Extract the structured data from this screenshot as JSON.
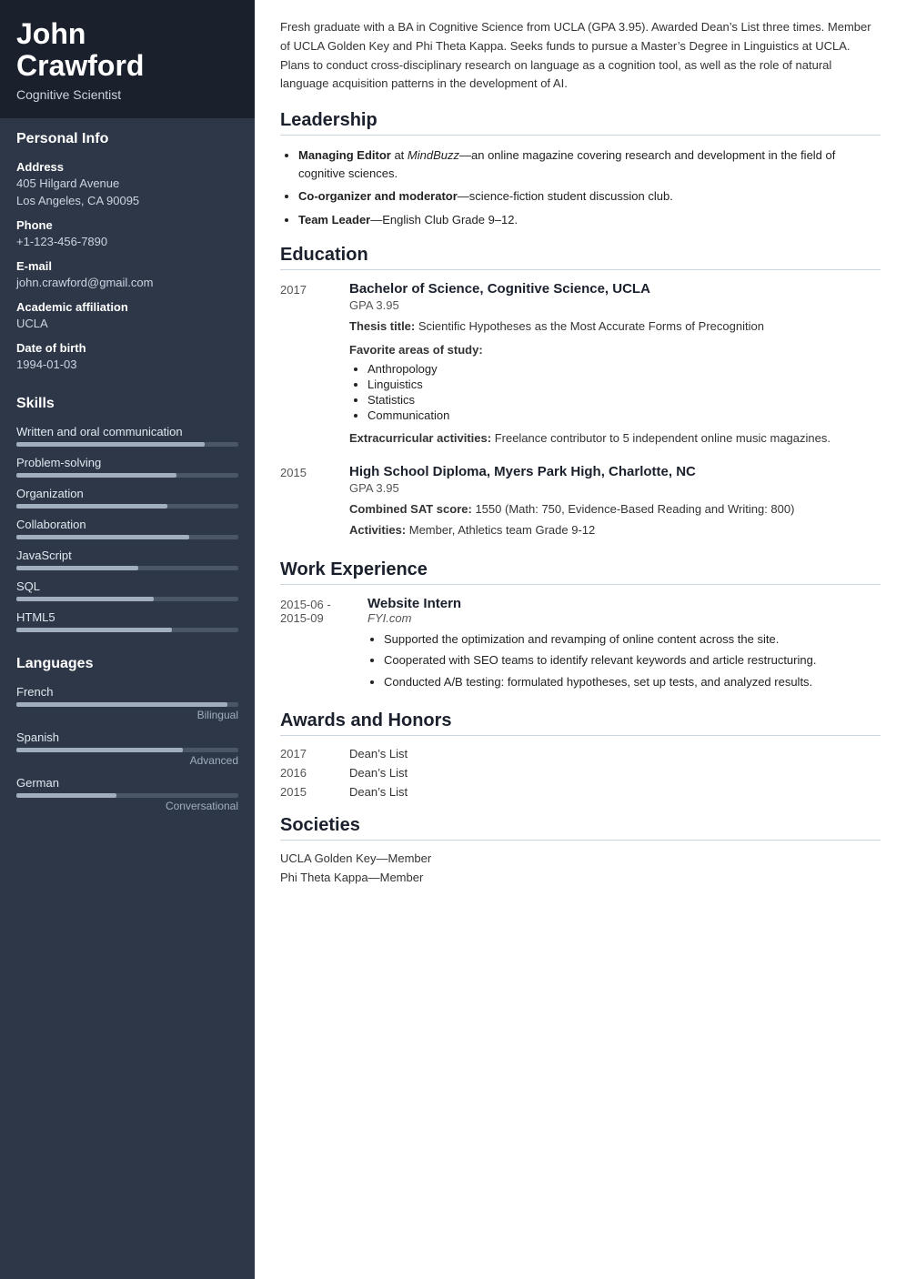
{
  "sidebar": {
    "name_line1": "John",
    "name_line2": "Crawford",
    "title": "Cognitive Scientist",
    "personal_info": {
      "section_title": "Personal Info",
      "address_label": "Address",
      "address_line1": "405 Hilgard Avenue",
      "address_line2": "Los Angeles, CA 90095",
      "phone_label": "Phone",
      "phone": "+1-123-456-7890",
      "email_label": "E-mail",
      "email": "john.crawford@gmail.com",
      "affiliation_label": "Academic affiliation",
      "affiliation": "UCLA",
      "dob_label": "Date of birth",
      "dob": "1994-01-03"
    },
    "skills": {
      "section_title": "Skills",
      "items": [
        {
          "name": "Written and oral communication",
          "pct": 85
        },
        {
          "name": "Problem-solving",
          "pct": 72
        },
        {
          "name": "Organization",
          "pct": 68
        },
        {
          "name": "Collaboration",
          "pct": 78
        },
        {
          "name": "JavaScript",
          "pct": 55
        },
        {
          "name": "SQL",
          "pct": 62
        },
        {
          "name": "HTML5",
          "pct": 70
        }
      ]
    },
    "languages": {
      "section_title": "Languages",
      "items": [
        {
          "name": "French",
          "pct": 95,
          "level": "Bilingual"
        },
        {
          "name": "Spanish",
          "pct": 75,
          "level": "Advanced"
        },
        {
          "name": "German",
          "pct": 45,
          "level": "Conversational"
        }
      ]
    }
  },
  "main": {
    "summary": "Fresh graduate with a BA in Cognitive Science from UCLA (GPA 3.95). Awarded Dean’s List three times. Member of UCLA Golden Key and Phi Theta Kappa. Seeks funds to pursue a Master’s Degree in Linguistics at UCLA. Plans to conduct cross-disciplinary research on language as a cognition tool, as well as the role of natural language acquisition patterns in the development of AI.",
    "leadership": {
      "section_title": "Leadership",
      "items": [
        {
          "bold": "Managing Editor",
          "italic_company": "MindBuzz",
          "rest": "—an online magazine covering research and development in the field of cognitive sciences."
        },
        {
          "bold": "Co-organizer and moderator",
          "rest": "—science-fiction student discussion club."
        },
        {
          "bold": "Team Leader",
          "rest": "—English Club Grade 9–12."
        }
      ]
    },
    "education": {
      "section_title": "Education",
      "items": [
        {
          "year": "2017",
          "degree": "Bachelor of Science, Cognitive Science, UCLA",
          "gpa": "GPA 3.95",
          "thesis_label": "Thesis title:",
          "thesis": "Scientific Hypotheses as the Most Accurate Forms of Precognition",
          "areas_label": "Favorite areas of study:",
          "areas": [
            "Anthropology",
            "Linguistics",
            "Statistics",
            "Communication"
          ],
          "extra_label": "Extracurricular activities:",
          "extra": "Freelance contributor to 5 independent online music magazines."
        },
        {
          "year": "2015",
          "degree": "High School Diploma, Myers Park High, Charlotte, NC",
          "gpa": "GPA 3.95",
          "sat_label": "Combined SAT score:",
          "sat": "1550 (Math: 750, Evidence-Based Reading and Writing: 800)",
          "act_label": "Activities:",
          "act": "Member, Athletics team Grade 9-12"
        }
      ]
    },
    "work": {
      "section_title": "Work Experience",
      "items": [
        {
          "dates": "2015-06 -\n2015-09",
          "title": "Website Intern",
          "company": "FYI.com",
          "bullets": [
            "Supported the optimization and revamping of online content across the site.",
            "Cooperated with SEO teams to identify relevant keywords and article restructuring.",
            "Conducted A/B testing: formulated hypotheses, set up tests, and analyzed results."
          ]
        }
      ]
    },
    "awards": {
      "section_title": "Awards and Honors",
      "items": [
        {
          "year": "2017",
          "name": "Dean’s List"
        },
        {
          "year": "2016",
          "name": "Dean’s List"
        },
        {
          "year": "2015",
          "name": "Dean’s List"
        }
      ]
    },
    "societies": {
      "section_title": "Societies",
      "items": [
        "UCLA Golden Key—Member",
        "Phi Theta Kappa—Member"
      ]
    }
  }
}
